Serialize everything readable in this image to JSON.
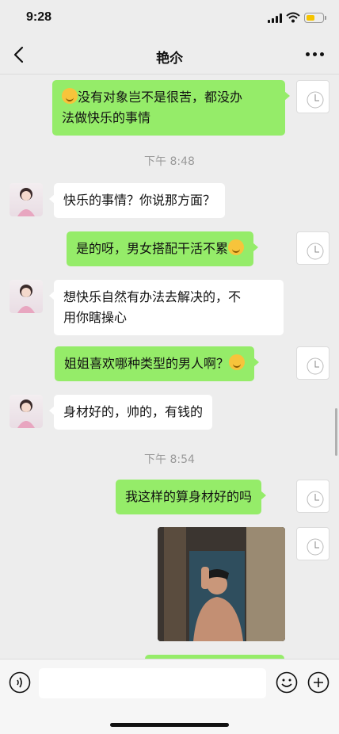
{
  "status_bar": {
    "time": "9:28",
    "battery_level": 0.55
  },
  "header": {
    "title": "艳尒"
  },
  "messages": [
    {
      "from": "me",
      "text": "没有对象岂不是很苦，都没办法做快乐的事情",
      "lines": [
        "没有对象岂不是很苦，都没办",
        "法做快乐的事情"
      ],
      "leading_emoji": "facepalm-emoji"
    },
    {
      "type": "time",
      "text": "下午 8:48"
    },
    {
      "from": "them",
      "text": "快乐的事情？你说那方面？"
    },
    {
      "from": "me",
      "text": "是的呀，男女搭配干活不累",
      "trailing_emoji": "grin-emoji"
    },
    {
      "from": "them",
      "text": "想快乐自然有办法去解决的，不用你瞎操心",
      "lines": [
        "想快乐自然有办法去解决的，不",
        "用你瞎操心"
      ]
    },
    {
      "from": "me",
      "text": "姐姐喜欢哪种类型的男人啊？",
      "trailing_emoji": "smile-emoji"
    },
    {
      "from": "them",
      "text": "身材好的，帅的，有钱的"
    },
    {
      "type": "time",
      "text": "下午 8:54"
    },
    {
      "from": "me",
      "text": "我这样的算身材好的吗"
    },
    {
      "from": "me",
      "type": "image",
      "content": "photo of shirtless man taking mirror selfie in bathroom"
    }
  ],
  "colors": {
    "my_bubble": "#95ec69",
    "their_bubble": "#ffffff",
    "background": "#ededed"
  },
  "input": {
    "placeholder": ""
  }
}
